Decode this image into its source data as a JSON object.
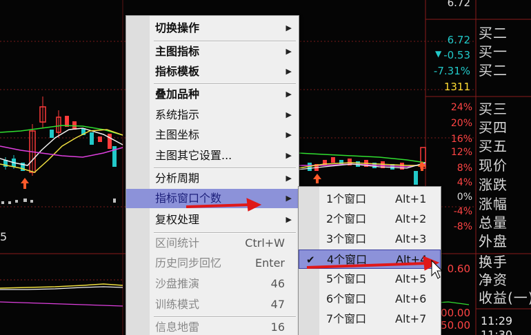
{
  "colors": {
    "bg": "#050505",
    "grid_red": "#7a1a1a",
    "up": "#ff3b3b",
    "down": "#22c9c9",
    "ma_white": "#f2f2f2",
    "ma_yellow": "#f0e040",
    "ma_magenta": "#e040e0",
    "ma_green": "#30e030",
    "menu_bg": "#efefef",
    "highlight": "#8c92d9",
    "annotation_arrow": "#e01818"
  },
  "right_panel": {
    "top_value": "6.72",
    "price": "6.72",
    "change": "-0.53",
    "change_icon": "triangle-down-icon",
    "change_pct": "-7.31%",
    "volume": "1311",
    "labels": [
      "买二",
      "买一",
      "买二",
      "买三",
      "买四",
      "买五",
      "现价",
      "涨跌",
      "涨幅",
      "总量",
      "外盘",
      "换手",
      "净资",
      "收益(一)"
    ],
    "pct_axis": [
      "24%",
      "20%",
      "16%",
      "12%",
      "8%",
      "4%",
      "0%",
      "-4%",
      "-8%"
    ],
    "lower_value": "0.60",
    "times": [
      "11:29",
      "11:30"
    ],
    "bottom_nums": [
      "00.00",
      "50.00"
    ]
  },
  "left_labels": {
    "bottom_left": "5"
  },
  "menu": {
    "items": [
      {
        "label": "切换操作",
        "submenu": true,
        "bold": true
      },
      {
        "label": "主图指标",
        "submenu": true,
        "bold": true
      },
      {
        "label": "指标模板",
        "submenu": true,
        "bold": true
      },
      {
        "label": "叠加品种",
        "submenu": true,
        "bold": true
      },
      {
        "label": "系统指示",
        "submenu": true,
        "bold": false
      },
      {
        "label": "主图坐标",
        "submenu": true,
        "bold": false
      },
      {
        "label": "主图其它设置...",
        "submenu": true,
        "bold": false
      },
      {
        "label": "分析周期",
        "submenu": true,
        "bold": false
      },
      {
        "label": "指标窗口个数",
        "submenu": true,
        "bold": false,
        "highlighted": true
      },
      {
        "label": "复权处理",
        "submenu": true,
        "bold": false
      },
      {
        "label": "区间统计",
        "shortcut": "Ctrl+W",
        "bold": false
      },
      {
        "label": "历史同步回忆",
        "shortcut": "Enter",
        "bold": false
      },
      {
        "label": "沙盘推演",
        "shortcut": "46",
        "bold": false
      },
      {
        "label": "训练模式",
        "shortcut": "47",
        "bold": false
      },
      {
        "label": "信息地雷",
        "shortcut": "16",
        "bold": false
      }
    ]
  },
  "submenu": {
    "items": [
      {
        "label": "1个窗口",
        "shortcut": "Alt+1"
      },
      {
        "label": "2个窗口",
        "shortcut": "Alt+2"
      },
      {
        "label": "3个窗口",
        "shortcut": "Alt+3"
      },
      {
        "label": "4个窗口",
        "shortcut": "Alt+4",
        "checked": true,
        "highlighted": true
      },
      {
        "label": "5个窗口",
        "shortcut": "Alt+5"
      },
      {
        "label": "6个窗口",
        "shortcut": "Alt+6"
      },
      {
        "label": "7个窗口",
        "shortcut": "Alt+7"
      }
    ]
  }
}
